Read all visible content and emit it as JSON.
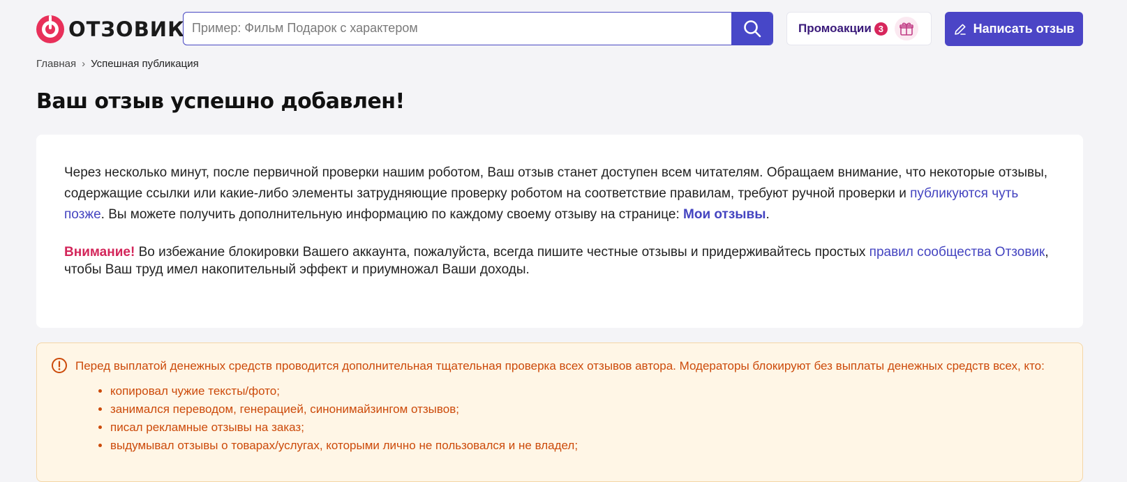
{
  "header": {
    "logo_text": "ОТЗОВИК",
    "search_placeholder": "Пример: Фильм Подарок с характером",
    "promo_label": "Промоакции",
    "promo_count": "3",
    "write_review_label": "Написать отзыв"
  },
  "breadcrumb": {
    "home": "Главная",
    "separator": "›",
    "current": "Успешная публикация"
  },
  "page_title": "Ваш отзыв успешно добавлен!",
  "card": {
    "p1_text_1": "Через несколько минут, после первичной проверки нашим роботом, Ваш отзыв станет доступен всем читателям. Обращаем внимание, что некоторые отзывы, содержащие ссылки или какие-либо элементы затрудняющие проверку роботом на соответствие правилам, требуют ручной проверки и ",
    "p1_link_later": "публикуются чуть позже",
    "p1_text_2": ". Вы можете получить дополнительную информацию по каждому своему отзыву на странице: ",
    "p1_link_my_reviews": "Мои отзывы",
    "p1_text_3": ".",
    "p2_warning": "Внимание!",
    "p2_text_1": " Во избежание блокировки Вашего аккаунта, пожалуйста, всегда пишите честные отзывы и придерживайтесь простых ",
    "p2_link_rules": "правил сообщества Отзовик",
    "p2_text_2": ", чтобы Ваш труд имел накопительный эффект и приумножал Ваши доходы."
  },
  "notice": {
    "text": "Перед выплатой денежных средств проводится дополнительная тщательная проверка всех отзывов автора. Модераторы блокируют без выплаты денежных средств всех, кто:",
    "items": [
      "копировал чужие тексты/фото;",
      "занимался переводом, генерацией, синонимайзингом отзывов;",
      "писал рекламные отзывы на заказ;",
      "выдумывал отзывы о товарах/услугах, которыми лично не пользовался и не владел;"
    ]
  },
  "colors": {
    "accent": "#4747c8",
    "brand_red": "#e8305a",
    "warning_text": "#cc4a0a",
    "notice_bg": "#fff6e6"
  }
}
